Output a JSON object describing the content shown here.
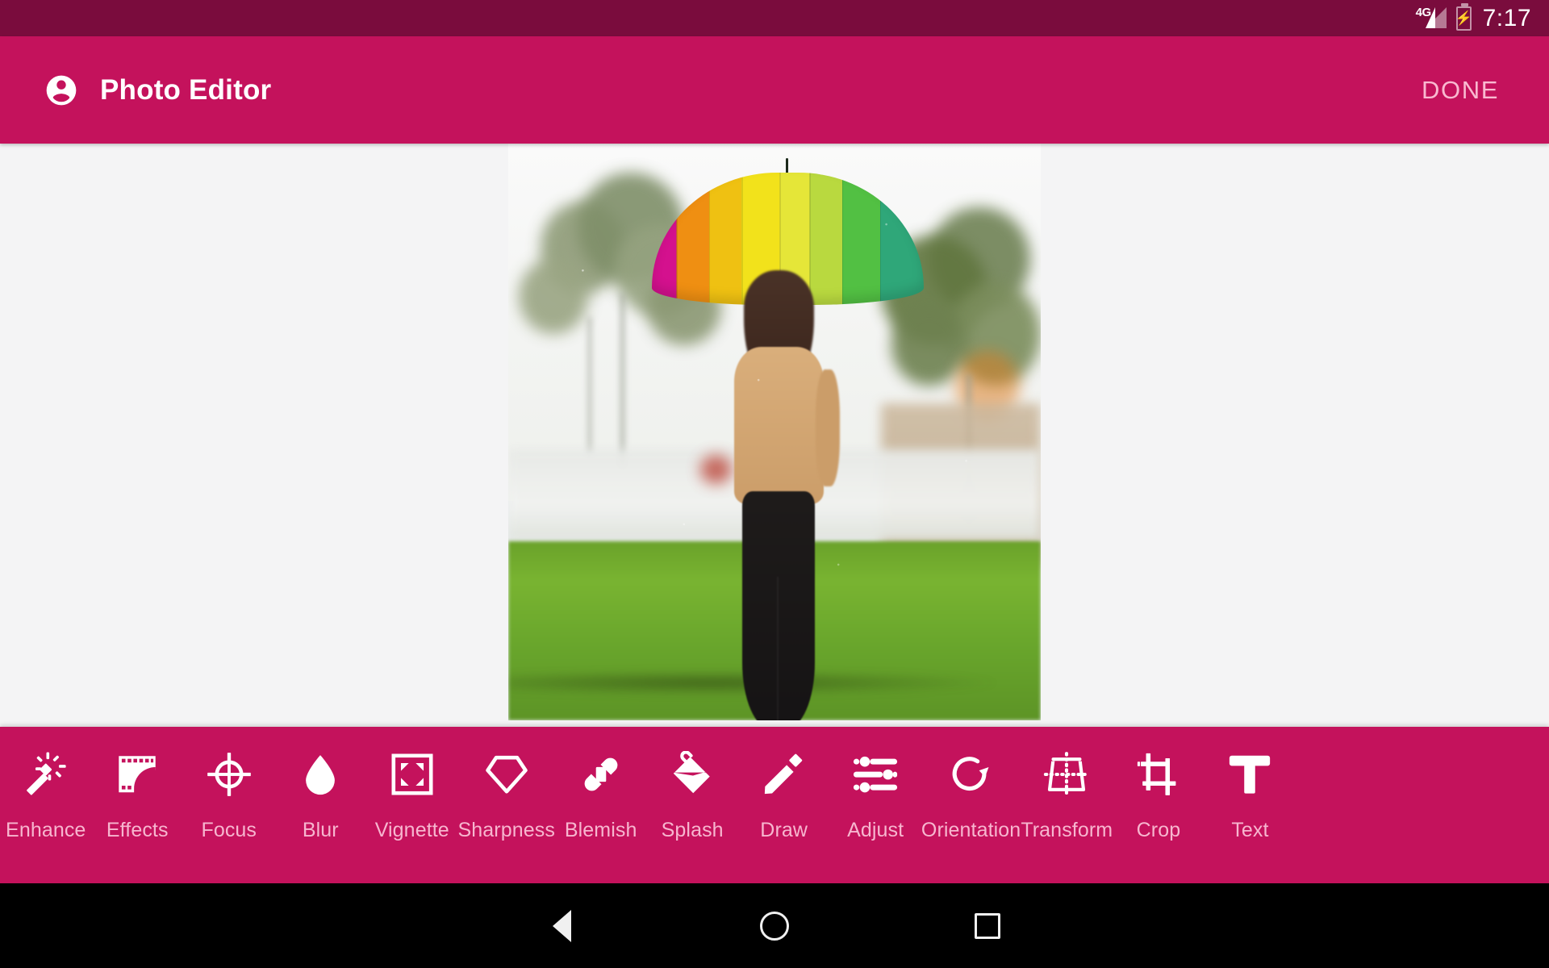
{
  "status_bar": {
    "network_label": "4G",
    "signal_icon": "signal-cellular-icon",
    "battery_icon": "battery-charging-icon",
    "time": "7:17"
  },
  "app_bar": {
    "avatar_icon": "account-circle-icon",
    "title": "Photo Editor",
    "done_label": "DONE",
    "background_color": "#c4125c",
    "title_color": "#ffffff",
    "done_color": "#f9b9d0"
  },
  "canvas": {
    "background_color": "#f4f4f5",
    "photo_description": "Woman walking away on grass holding a rainbow-striped umbrella in the rain",
    "umbrella_colors": [
      "#d4118e",
      "#ef8f12",
      "#efc112",
      "#f2e21b",
      "#e5e638",
      "#b9d93f",
      "#52c043",
      "#2fa779"
    ]
  },
  "toolbar": {
    "background_color": "#c4125c",
    "label_color": "#f7b6cf",
    "items": [
      {
        "label": "Enhance",
        "icon": "magic-wand-icon"
      },
      {
        "label": "Effects",
        "icon": "film-strip-icon"
      },
      {
        "label": "Focus",
        "icon": "crosshair-target-icon"
      },
      {
        "label": "Blur",
        "icon": "water-drop-icon"
      },
      {
        "label": "Vignette",
        "icon": "corner-frame-icon"
      },
      {
        "label": "Sharpness",
        "icon": "diamond-gem-icon"
      },
      {
        "label": "Blemish",
        "icon": "bandage-icon"
      },
      {
        "label": "Splash",
        "icon": "paint-bucket-icon"
      },
      {
        "label": "Draw",
        "icon": "pencil-icon"
      },
      {
        "label": "Adjust",
        "icon": "sliders-icon"
      },
      {
        "label": "Orientation",
        "icon": "rotate-right-icon"
      },
      {
        "label": "Transform",
        "icon": "perspective-transform-icon"
      },
      {
        "label": "Crop",
        "icon": "crop-icon"
      },
      {
        "label": "Text",
        "icon": "text-format-icon"
      }
    ]
  },
  "nav_bar": {
    "background_color": "#000000",
    "back_icon": "back-triangle-icon",
    "home_icon": "home-circle-icon",
    "recents_icon": "recents-square-icon"
  }
}
